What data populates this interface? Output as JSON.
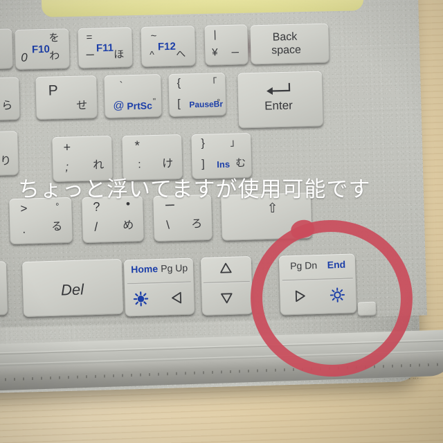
{
  "scene": {
    "title": "Japanese laptop keyboard close-up photo with handwritten annotations",
    "surface": "wooden desk",
    "colors": {
      "wood": "#e8d7b2",
      "keyboard_body": "#c2c3bd",
      "key_face": "#cfd0ca",
      "glyph_dark": "#36373a",
      "glyph_blue": "#1d3fa8",
      "annotation_red": "#ca4c5b",
      "caption_white": "#ffffff",
      "yellow_object": "#e8e49d"
    }
  },
  "annotations": {
    "caption_text": "ちょっと浮いてますが使用可能です",
    "caption_meaning_note": "handwritten white Japanese caption overlaid on keyboard",
    "red_circle_target": "PgDn / End / right-arrow / brightness key"
  },
  "keyboard": {
    "rows": [
      {
        "name": "function-number-row",
        "keys": [
          {
            "id": "key-0-f10",
            "top_left": "を",
            "top_right": "",
            "fn": "F10",
            "main": "0",
            "sub": "わ"
          },
          {
            "id": "key-minus-f11",
            "top_left": "=",
            "top_right": "",
            "fn": "F11",
            "main": "ー",
            "sub": "ほ"
          },
          {
            "id": "key-caret-f12",
            "top_left": "~",
            "top_right": "",
            "fn": "F12",
            "main": "^",
            "sub": "へ"
          },
          {
            "id": "key-yen",
            "top_left": "|",
            "top_right": "",
            "fn": "",
            "main": "¥",
            "sub": "ー"
          },
          {
            "id": "key-backspace",
            "label_line1": "Back",
            "label_line2": "space"
          }
        ]
      },
      {
        "name": "qwerty-top-row",
        "keys": [
          {
            "id": "key-ra",
            "main": "",
            "sub": "ら"
          },
          {
            "id": "key-p",
            "main": "P",
            "sub": "せ"
          },
          {
            "id": "key-at-prtsc",
            "top": "`",
            "main": "@",
            "fn": "PrtSc",
            "sub": "\""
          },
          {
            "id": "key-bracket-pausebr",
            "top_left": "{",
            "top_right": "「",
            "main": "[",
            "fn": "PauseBr",
            "sub": "°"
          },
          {
            "id": "key-enter",
            "label": "Enter",
            "icon": "enter-arrow-icon"
          }
        ]
      },
      {
        "name": "home-row",
        "keys": [
          {
            "id": "key-ri",
            "sub": "り"
          },
          {
            "id": "key-plus-semicolon",
            "top": "+",
            "main": ";",
            "sub": "れ"
          },
          {
            "id": "key-asterisk-colon",
            "top": "*",
            "main": ":",
            "sub": "け"
          },
          {
            "id": "key-brace-ins",
            "top_left": "}",
            "top_right": "」",
            "main": "]",
            "fn": "Ins",
            "sub": "む"
          }
        ]
      },
      {
        "name": "bottom-letter-row",
        "keys": [
          {
            "id": "key-gt-period",
            "top_left": ">",
            "top_right": "°",
            "main": ".",
            "sub": "る"
          },
          {
            "id": "key-question-slash",
            "top_left": "?",
            "top_right": "●",
            "main": "/",
            "sub": "め"
          },
          {
            "id": "key-underscore-backslash",
            "top": "ー",
            "main": "\\",
            "sub": "ろ"
          },
          {
            "id": "key-shift-right",
            "icon": "shift-arrow-icon",
            "label": "⇧"
          }
        ]
      },
      {
        "name": "navigation-row",
        "keys": [
          {
            "id": "key-del",
            "label": "Del"
          },
          {
            "id": "key-home-pgup-left",
            "fn_blue": "Home",
            "fn_dark": "Pg Up",
            "icon_blue": "brightness-sun-icon",
            "icon_dark": "arrow-left-icon"
          },
          {
            "id": "key-up-down",
            "icon_top": "arrow-up-icon",
            "icon_bottom": "arrow-down-icon"
          },
          {
            "id": "key-pgdn-end-right",
            "fn_dark": "Pg Dn",
            "fn_blue": "End",
            "icon_dark": "arrow-right-icon",
            "icon_blue": "brightness-gear-icon",
            "circled": true
          }
        ]
      }
    ]
  }
}
